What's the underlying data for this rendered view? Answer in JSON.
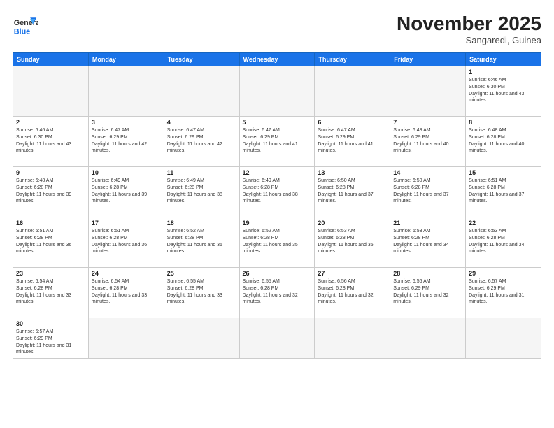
{
  "header": {
    "logo_general": "General",
    "logo_blue": "Blue",
    "month_title": "November 2025",
    "subtitle": "Sangaredi, Guinea"
  },
  "days_of_week": [
    "Sunday",
    "Monday",
    "Tuesday",
    "Wednesday",
    "Thursday",
    "Friday",
    "Saturday"
  ],
  "weeks": [
    [
      {
        "day": "",
        "empty": true
      },
      {
        "day": "",
        "empty": true
      },
      {
        "day": "",
        "empty": true
      },
      {
        "day": "",
        "empty": true
      },
      {
        "day": "",
        "empty": true
      },
      {
        "day": "",
        "empty": true
      },
      {
        "day": "1",
        "sunrise": "6:46 AM",
        "sunset": "6:30 PM",
        "daylight": "11 hours and 43 minutes."
      }
    ],
    [
      {
        "day": "2",
        "sunrise": "6:46 AM",
        "sunset": "6:30 PM",
        "daylight": "11 hours and 43 minutes."
      },
      {
        "day": "3",
        "sunrise": "6:47 AM",
        "sunset": "6:29 PM",
        "daylight": "11 hours and 42 minutes."
      },
      {
        "day": "4",
        "sunrise": "6:47 AM",
        "sunset": "6:29 PM",
        "daylight": "11 hours and 42 minutes."
      },
      {
        "day": "5",
        "sunrise": "6:47 AM",
        "sunset": "6:29 PM",
        "daylight": "11 hours and 41 minutes."
      },
      {
        "day": "6",
        "sunrise": "6:47 AM",
        "sunset": "6:29 PM",
        "daylight": "11 hours and 41 minutes."
      },
      {
        "day": "7",
        "sunrise": "6:48 AM",
        "sunset": "6:29 PM",
        "daylight": "11 hours and 40 minutes."
      },
      {
        "day": "8",
        "sunrise": "6:48 AM",
        "sunset": "6:28 PM",
        "daylight": "11 hours and 40 minutes."
      }
    ],
    [
      {
        "day": "9",
        "sunrise": "6:48 AM",
        "sunset": "6:28 PM",
        "daylight": "11 hours and 39 minutes."
      },
      {
        "day": "10",
        "sunrise": "6:49 AM",
        "sunset": "6:28 PM",
        "daylight": "11 hours and 39 minutes."
      },
      {
        "day": "11",
        "sunrise": "6:49 AM",
        "sunset": "6:28 PM",
        "daylight": "11 hours and 38 minutes."
      },
      {
        "day": "12",
        "sunrise": "6:49 AM",
        "sunset": "6:28 PM",
        "daylight": "11 hours and 38 minutes."
      },
      {
        "day": "13",
        "sunrise": "6:50 AM",
        "sunset": "6:28 PM",
        "daylight": "11 hours and 37 minutes."
      },
      {
        "day": "14",
        "sunrise": "6:50 AM",
        "sunset": "6:28 PM",
        "daylight": "11 hours and 37 minutes."
      },
      {
        "day": "15",
        "sunrise": "6:51 AM",
        "sunset": "6:28 PM",
        "daylight": "11 hours and 37 minutes."
      }
    ],
    [
      {
        "day": "16",
        "sunrise": "6:51 AM",
        "sunset": "6:28 PM",
        "daylight": "11 hours and 36 minutes."
      },
      {
        "day": "17",
        "sunrise": "6:51 AM",
        "sunset": "6:28 PM",
        "daylight": "11 hours and 36 minutes."
      },
      {
        "day": "18",
        "sunrise": "6:52 AM",
        "sunset": "6:28 PM",
        "daylight": "11 hours and 35 minutes."
      },
      {
        "day": "19",
        "sunrise": "6:52 AM",
        "sunset": "6:28 PM",
        "daylight": "11 hours and 35 minutes."
      },
      {
        "day": "20",
        "sunrise": "6:53 AM",
        "sunset": "6:28 PM",
        "daylight": "11 hours and 35 minutes."
      },
      {
        "day": "21",
        "sunrise": "6:53 AM",
        "sunset": "6:28 PM",
        "daylight": "11 hours and 34 minutes."
      },
      {
        "day": "22",
        "sunrise": "6:53 AM",
        "sunset": "6:28 PM",
        "daylight": "11 hours and 34 minutes."
      }
    ],
    [
      {
        "day": "23",
        "sunrise": "6:54 AM",
        "sunset": "6:28 PM",
        "daylight": "11 hours and 33 minutes."
      },
      {
        "day": "24",
        "sunrise": "6:54 AM",
        "sunset": "6:28 PM",
        "daylight": "11 hours and 33 minutes."
      },
      {
        "day": "25",
        "sunrise": "6:55 AM",
        "sunset": "6:28 PM",
        "daylight": "11 hours and 33 minutes."
      },
      {
        "day": "26",
        "sunrise": "6:55 AM",
        "sunset": "6:28 PM",
        "daylight": "11 hours and 32 minutes."
      },
      {
        "day": "27",
        "sunrise": "6:56 AM",
        "sunset": "6:28 PM",
        "daylight": "11 hours and 32 minutes."
      },
      {
        "day": "28",
        "sunrise": "6:56 AM",
        "sunset": "6:29 PM",
        "daylight": "11 hours and 32 minutes."
      },
      {
        "day": "29",
        "sunrise": "6:57 AM",
        "sunset": "6:29 PM",
        "daylight": "11 hours and 31 minutes."
      }
    ],
    [
      {
        "day": "30",
        "sunrise": "6:57 AM",
        "sunset": "6:29 PM",
        "daylight": "11 hours and 31 minutes."
      },
      {
        "day": "",
        "empty": true
      },
      {
        "day": "",
        "empty": true
      },
      {
        "day": "",
        "empty": true
      },
      {
        "day": "",
        "empty": true
      },
      {
        "day": "",
        "empty": true
      },
      {
        "day": "",
        "empty": true
      }
    ]
  ]
}
